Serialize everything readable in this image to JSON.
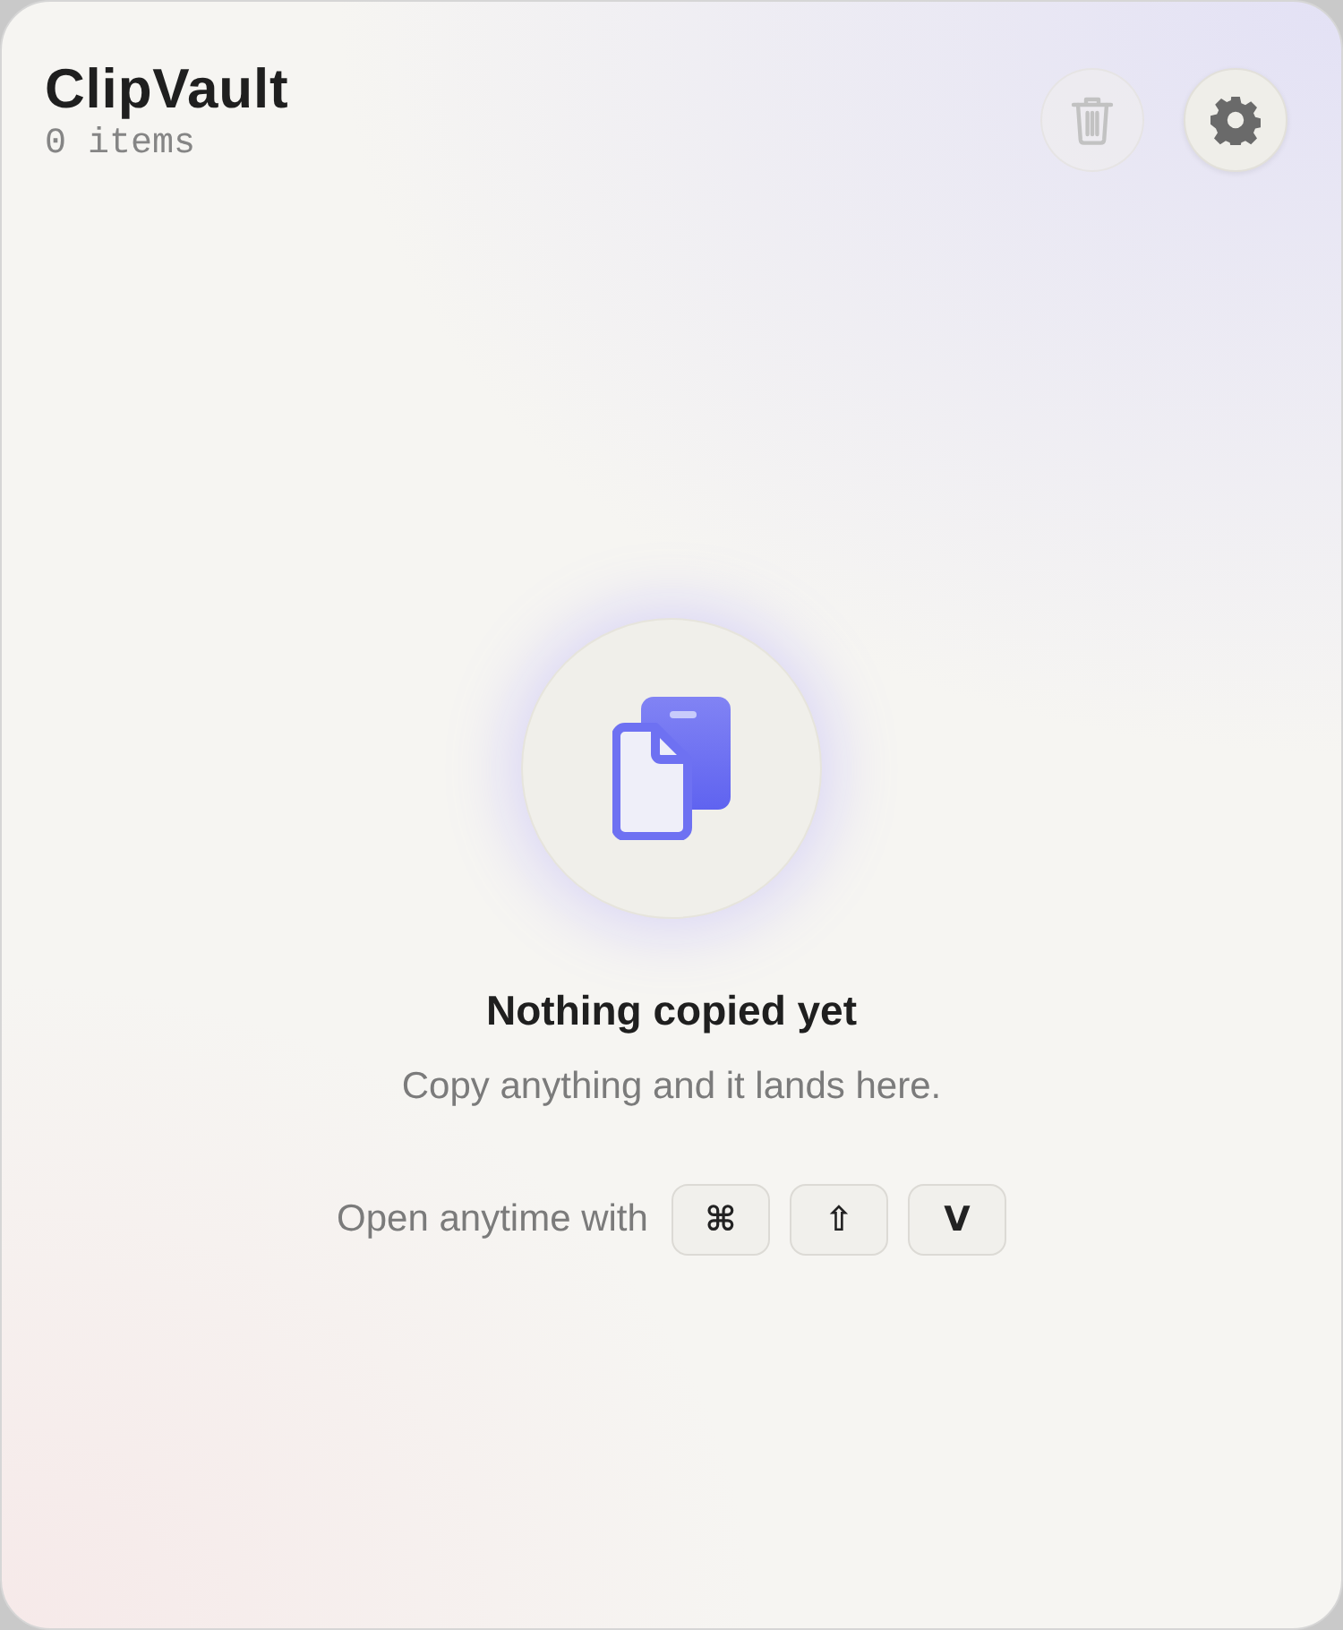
{
  "header": {
    "title": "ClipVault",
    "count": "0 items"
  },
  "actions": [
    {
      "kind": "clear",
      "disabled": true
    },
    {
      "kind": "settings",
      "disabled": false
    }
  ],
  "empty_state": {
    "title": "Nothing copied yet",
    "message": "Copy anything and it lands here.",
    "shortcut_label": "Open anytime with",
    "keys": [
      "⌘",
      "⇧",
      "V"
    ]
  }
}
